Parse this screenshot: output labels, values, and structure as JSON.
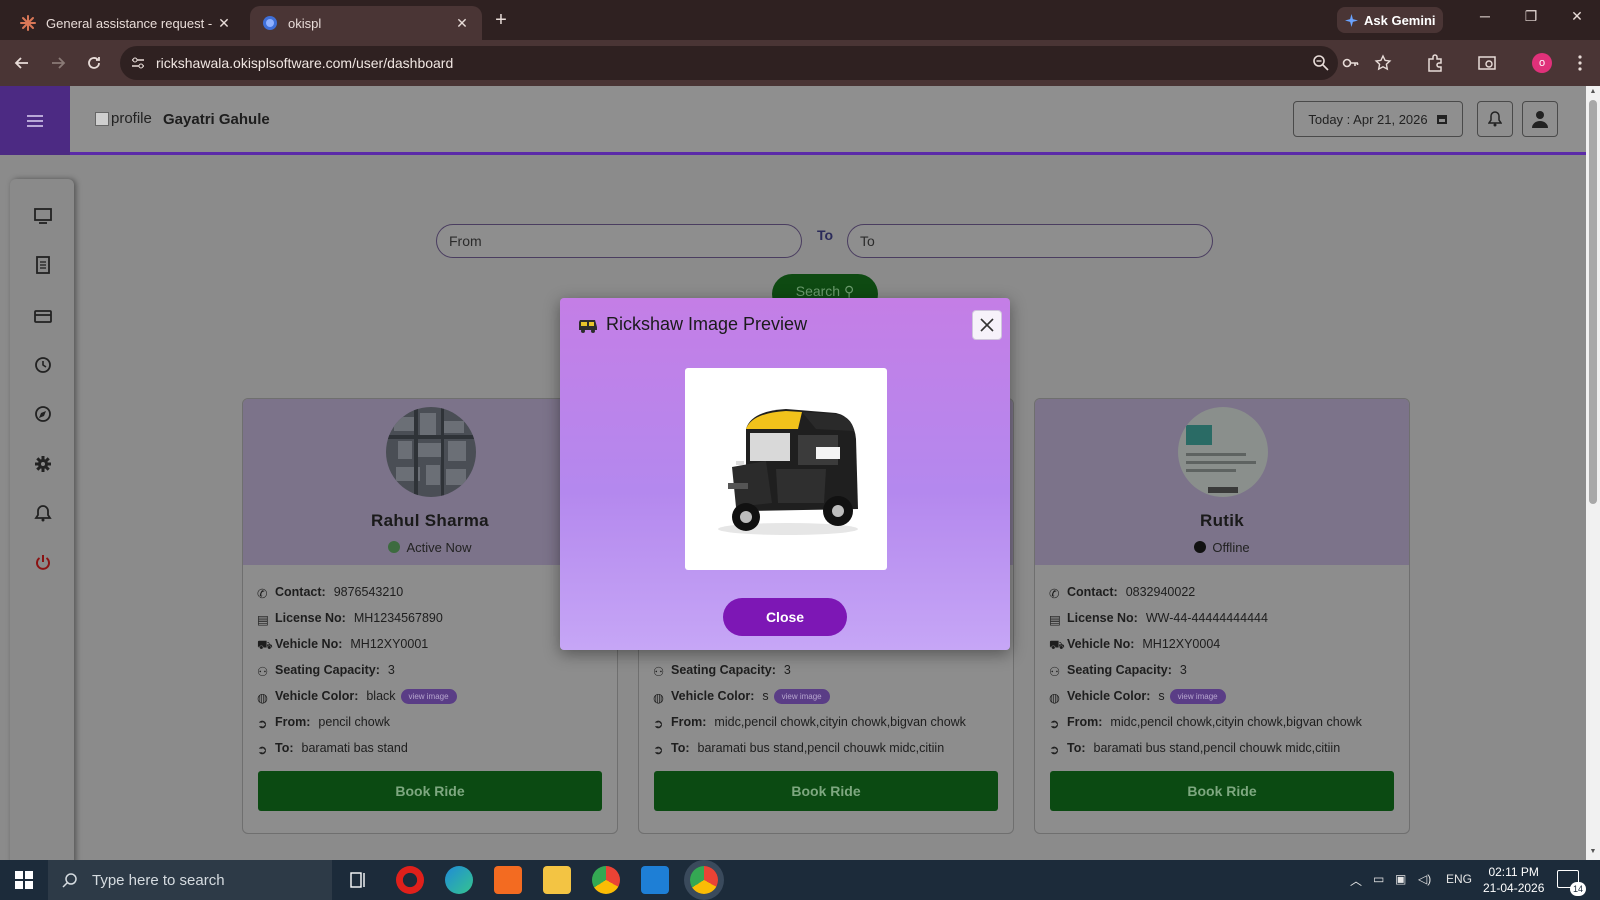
{
  "browser": {
    "tabs": [
      {
        "title": "General assistance request - Cla",
        "active": false
      },
      {
        "title": "okispl",
        "active": true
      }
    ],
    "gemini_label": "Ask Gemini",
    "url": "rickshawala.okisplsoftware.com/user/dashboard",
    "profile_initial": "o"
  },
  "header": {
    "profile_alt": "profile",
    "username": "Gayatri Gahule",
    "date_label": "Today : Apr 21, 2026"
  },
  "search": {
    "from_placeholder": "From",
    "to_label": "To",
    "to_placeholder": "To",
    "button_label": "Search"
  },
  "cards": [
    {
      "name": "Rahul Sharma",
      "status": "Active Now",
      "status_color": "#2e7d32",
      "contact": "9876543210",
      "license": "MH1234567890",
      "vehicle_no": "MH12XY0001",
      "seating": "3",
      "color": "black",
      "from": "pencil chowk",
      "to": "baramati bas stand"
    },
    {
      "name": "",
      "status": "",
      "contact": "",
      "license": "",
      "vehicle_no": "",
      "seating": "3",
      "color": "s",
      "from": "midc,pencil chowk,cityin chowk,bigvan chowk",
      "to": "baramati bus stand,pencil chouwk midc,citiin"
    },
    {
      "name": "Rutik",
      "status": "Offline",
      "status_color": "#111111",
      "contact": "0832940022",
      "license": "WW-44-44444444444",
      "vehicle_no": "MH12XY0004",
      "seating": "3",
      "color": "s",
      "from": "midc,pencil chowk,cityin chowk,bigvan chowk",
      "to": "baramati bus stand,pencil chouwk midc,citiin"
    }
  ],
  "labels": {
    "contact": "Contact:",
    "license": "License No:",
    "vehicle_no": "Vehicle No:",
    "seating": "Seating Capacity:",
    "color": "Vehicle Color:",
    "from": "From:",
    "to": "To:",
    "view_image": "view image",
    "book_ride": "Book Ride"
  },
  "modal": {
    "title": "Rickshaw Image Preview",
    "close_label": "Close"
  },
  "taskbar": {
    "search_placeholder": "Type here to search",
    "language": "ENG",
    "time": "02:11 PM",
    "date": "21-04-2026",
    "notification_count": "14"
  },
  "colors": {
    "accent": "#5b2aa8",
    "book_green": "#0b4a12",
    "modal_button": "#7d17b5"
  }
}
